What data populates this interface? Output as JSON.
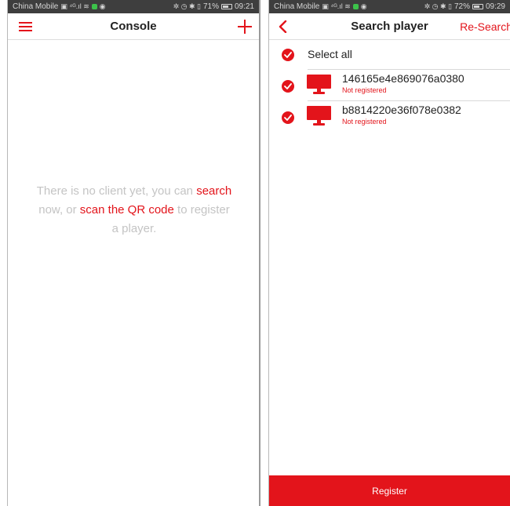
{
  "left_screen": {
    "status_bar": {
      "carrier": "China Mobile",
      "battery": "71%",
      "time": "09:21"
    },
    "navbar": {
      "title": "Console"
    },
    "empty_message": {
      "part1": "There is no client yet, you can",
      "link_search": "search",
      "part2": "now, or",
      "link_scan": "scan the QR code",
      "part3": "to register a player."
    }
  },
  "right_screen": {
    "status_bar": {
      "carrier": "China Mobile",
      "battery": "72%",
      "time": "09:29"
    },
    "navbar": {
      "title": "Search player",
      "action_label": "Re-Search"
    },
    "select_all_label": "Select all",
    "players": [
      {
        "id": "146165e4e869076a0380",
        "status": "Not registered",
        "checked": true
      },
      {
        "id": "b8814220e36f078e0382",
        "status": "Not registered",
        "checked": true
      }
    ],
    "register_label": "Register"
  },
  "colors": {
    "accent": "#e3141b",
    "status_bar": "#3e3e3e",
    "muted_text": "#c4c4c4"
  },
  "icons": [
    "menu-icon",
    "add-icon",
    "back-icon",
    "check-icon",
    "monitor-icon"
  ]
}
